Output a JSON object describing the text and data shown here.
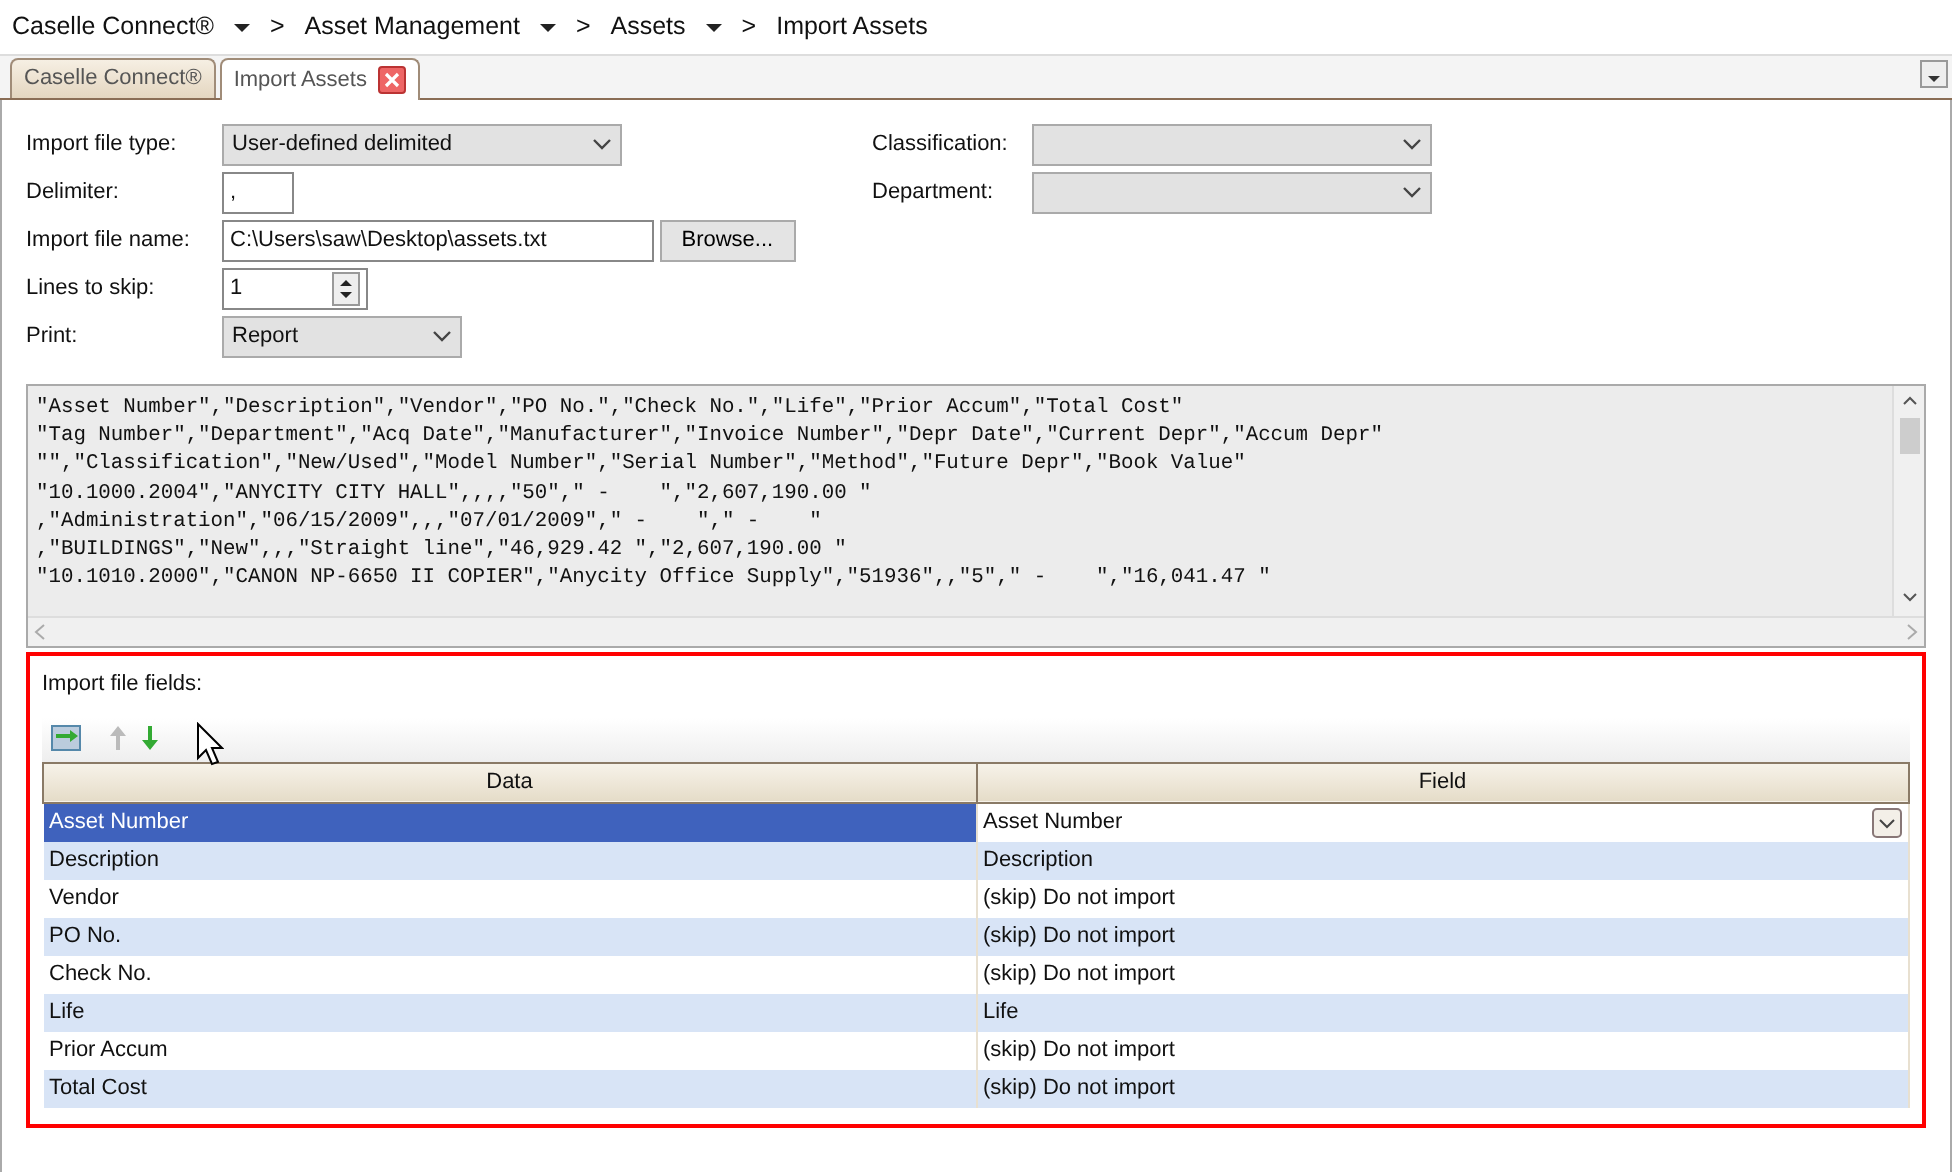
{
  "breadcrumb": [
    {
      "label": "Caselle Connect®",
      "has_menu": true
    },
    {
      "label": "Asset Management",
      "has_menu": true
    },
    {
      "label": "Assets",
      "has_menu": true
    },
    {
      "label": "Import Assets",
      "has_menu": false
    }
  ],
  "breadcrumb_separator": ">",
  "tabs": [
    {
      "label": "Caselle Connect®",
      "selected": false,
      "closable": false
    },
    {
      "label": "Import Assets",
      "selected": true,
      "closable": true
    }
  ],
  "form_left": [
    {
      "kind": "select",
      "label": "Import file type:",
      "value": "User-defined delimited"
    },
    {
      "kind": "text",
      "label": "Delimiter:",
      "value": ","
    },
    {
      "kind": "file",
      "label": "Import file name:",
      "value": "C:\\Users\\saw\\Desktop\\assets.txt",
      "button": "Browse..."
    },
    {
      "kind": "spin",
      "label": "Lines to skip:",
      "value": "1"
    },
    {
      "kind": "select",
      "label": "Print:",
      "value": "Report"
    }
  ],
  "form_right": [
    {
      "kind": "select",
      "label": "Classification:",
      "disabled": true
    },
    {
      "kind": "select",
      "label": "Department:",
      "disabled": true
    }
  ],
  "preview_lines": [
    "\"Asset Number\",\"Description\",\"Vendor\",\"PO No.\",\"Check No.\",\"Life\",\"Prior Accum\",\"Total Cost\"",
    "\"Tag Number\",\"Department\",\"Acq Date\",\"Manufacturer\",\"Invoice Number\",\"Depr Date\",\"Current Depr\",\"Accum Depr\"",
    "\"\",\"Classification\",\"New/Used\",\"Model Number\",\"Serial Number\",\"Method\",\"Future Depr\",\"Book Value\"",
    "\"10.1000.2004\",\"ANYCITY CITY HALL\",,,,\"50\",\" -    \",\"2,607,190.00 \"",
    ",\"Administration\",\"06/15/2009\",,,\"07/01/2009\",\" -    \",\" -    \"",
    ",\"BUILDINGS\",\"New\",,,\"Straight line\",\"46,929.42 \",\"2,607,190.00 \"",
    "\"10.1010.2000\",\"CANON NP-6650 II COPIER\",\"Anycity Office Supply\",\"51936\",,\"5\",\" -    \",\"16,041.47 \""
  ],
  "fields_section": {
    "label": "Import file fields:",
    "columns": [
      "Data",
      "Field"
    ],
    "rows": [
      {
        "data": "Asset Number",
        "field": "Asset Number",
        "selected": true
      },
      {
        "data": "Description",
        "field": "Description",
        "selected": false
      },
      {
        "data": "Vendor",
        "field": "(skip) Do not import",
        "selected": false
      },
      {
        "data": "PO No.",
        "field": "(skip) Do not import",
        "selected": false
      },
      {
        "data": "Check No.",
        "field": "(skip) Do not import",
        "selected": false
      },
      {
        "data": "Life",
        "field": "Life",
        "selected": false
      },
      {
        "data": "Prior Accum",
        "field": "(skip) Do not import",
        "selected": false
      },
      {
        "data": "Total Cost",
        "field": "(skip) Do not import",
        "selected": false
      }
    ]
  }
}
